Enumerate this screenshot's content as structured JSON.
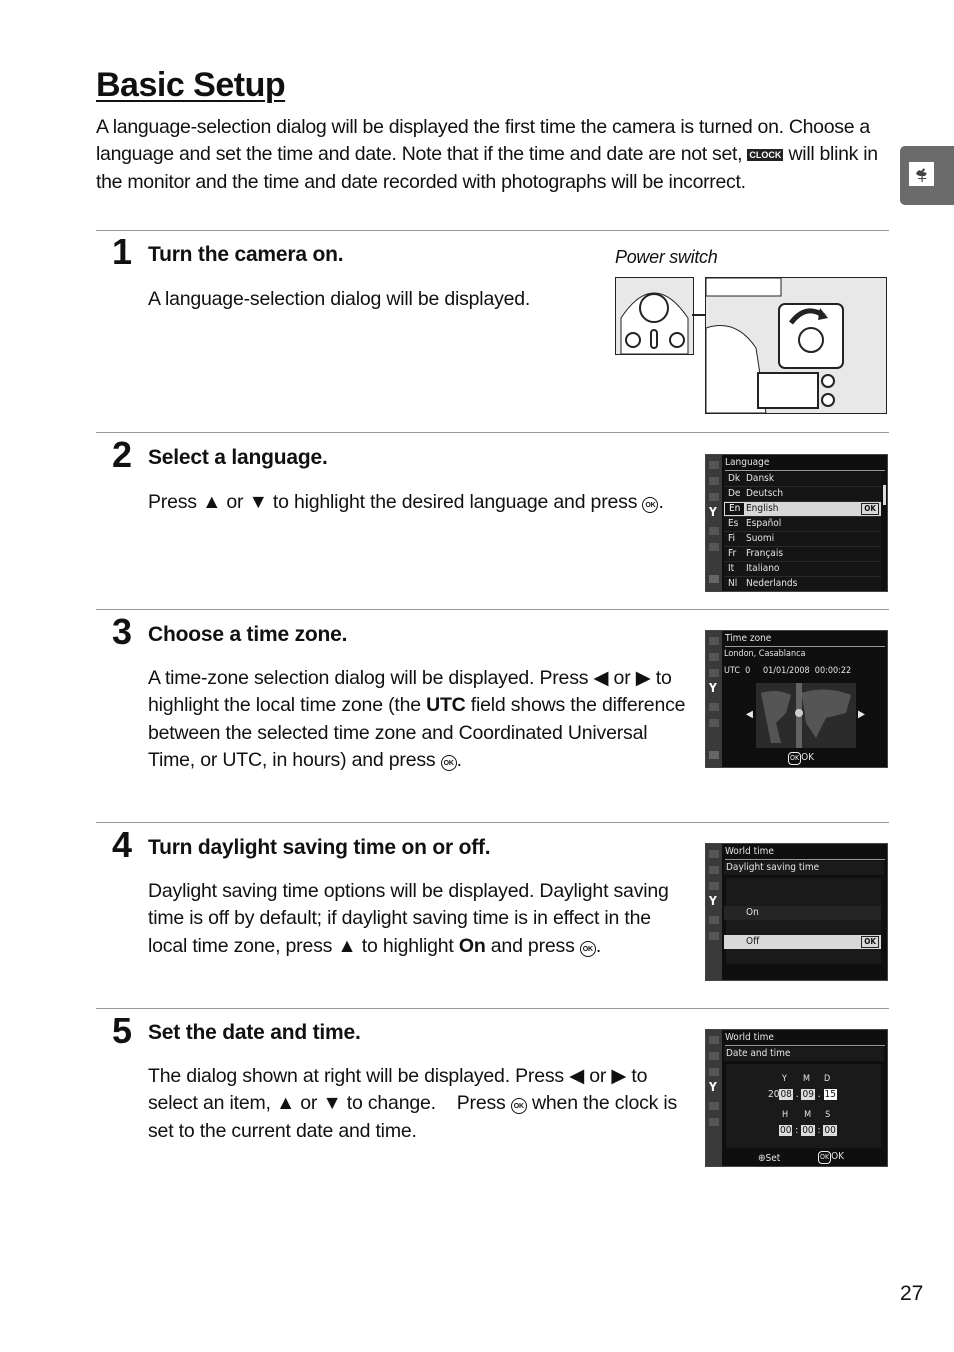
{
  "page": {
    "title": "Basic Setup",
    "intro_1": "A language-selection dialog will be displayed the first time the camera is turned on. Choose a language and set the time and date.  Note that if the time and date are not set,",
    "clock_icon_label": "CLOCK",
    "intro_2": "will blink in the monitor and the time and date recorded with photographs will be incorrect.",
    "side_tab_icon": "weathervane-icon",
    "page_number": "27"
  },
  "glyphs": {
    "up": "▲",
    "down": "▼",
    "left": "◀",
    "right": "▶",
    "ok": "OK"
  },
  "steps": [
    {
      "number": "1",
      "title": "Turn the camera on.",
      "body": "A language-selection dialog will be displayed.",
      "figure_caption": "Power switch"
    },
    {
      "number": "2",
      "title": "Select a language.",
      "body_parts": [
        "Press",
        "or",
        "to highlight the desired language and press",
        "."
      ]
    },
    {
      "number": "3",
      "title": "Choose a time zone.",
      "body_parts": [
        "A time-zone selection dialog will be displayed.  Press",
        "or",
        "to highlight the local time zone (the",
        "UTC",
        "field shows the difference between the selected time zone and Coordinated Universal Time, or UTC, in hours) and press",
        "."
      ]
    },
    {
      "number": "4",
      "title": "Turn daylight saving time on or off.",
      "body_parts": [
        "Daylight saving time options will be displayed.  Daylight saving time is off by default; if daylight saving time is in effect in the local time zone, press",
        "to highlight",
        "On",
        "and press",
        "."
      ]
    },
    {
      "number": "5",
      "title": "Set the date and time.",
      "body_parts": [
        "The dialog shown at right will be displayed.  Press",
        "or",
        "to select an item,",
        "or",
        "to change.    Press",
        "when the clock is set to the current date and time."
      ]
    }
  ],
  "screens": {
    "language": {
      "header": "Language",
      "items": [
        {
          "code": "Dk",
          "name": "Dansk"
        },
        {
          "code": "De",
          "name": "Deutsch"
        },
        {
          "code": "En",
          "name": "English",
          "selected": true
        },
        {
          "code": "Es",
          "name": "Español"
        },
        {
          "code": "Fi",
          "name": "Suomi"
        },
        {
          "code": "Fr",
          "name": "Français"
        },
        {
          "code": "It",
          "name": "Italiano"
        },
        {
          "code": "Nl",
          "name": "Nederlands"
        }
      ],
      "ok_label": "OK"
    },
    "timezone": {
      "header": "Time zone",
      "city": "London, Casablanca",
      "utc": "UTC  0",
      "datetime": "01/01/2008  00:00:22",
      "footer": "OK"
    },
    "dst": {
      "header": "World time",
      "subheader": "Daylight saving time",
      "options": [
        "On",
        "Off"
      ],
      "selected": "Off",
      "ok_label": "OK"
    },
    "datetime": {
      "header": "World time",
      "subheader": "Date and time",
      "date_labels": [
        "Y",
        "M",
        "D"
      ],
      "year_prefix": "20",
      "year_suffix": "08",
      "month": "09",
      "day": "15",
      "time_labels": [
        "H",
        "M",
        "S"
      ],
      "hour": "00",
      "minute": "00",
      "second": "00",
      "footer_set": "Set",
      "footer_ok": "OK"
    }
  }
}
